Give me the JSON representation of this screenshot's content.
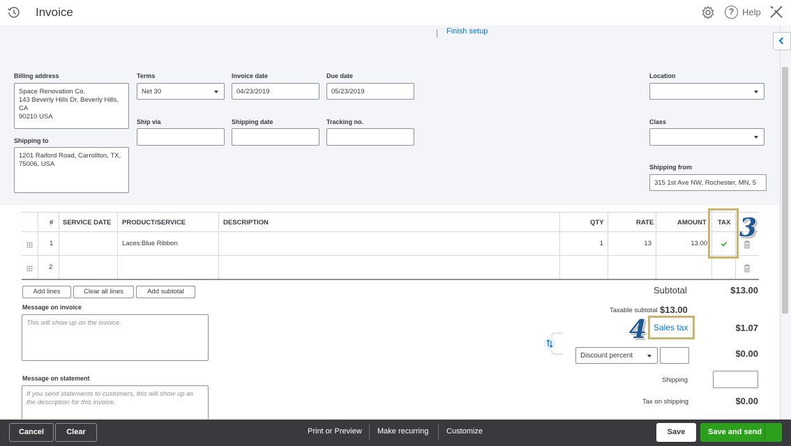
{
  "header": {
    "title": "Invoice",
    "help_label": "Help"
  },
  "setup": {
    "finish_setup": "Finish setup"
  },
  "form": {
    "billing_address_label": "Billing address",
    "billing_address_value": "Space Renovation Co.\n143 Beverly Hills Dr, Beverly Hills, CA\n90210 USA",
    "shipping_to_label": "Shipping to",
    "shipping_to_value": "1201 Raiford Road, Carrollton, TX, 75006, USA",
    "terms_label": "Terms",
    "terms_value": "Net 30",
    "invoice_date_label": "Invoice date",
    "invoice_date_value": "04/23/2019",
    "due_date_label": "Due date",
    "due_date_value": "05/23/2019",
    "ship_via_label": "Ship via",
    "ship_via_value": "",
    "shipping_date_label": "Shipping date",
    "shipping_date_value": "",
    "tracking_no_label": "Tracking no.",
    "tracking_no_value": "",
    "location_label": "Location",
    "location_value": "",
    "class_label": "Class",
    "class_value": "",
    "shipping_from_label": "Shipping from",
    "shipping_from_value": "315 1st Ave NW, Rochester, MN, 5"
  },
  "table": {
    "headers": {
      "num": "#",
      "service_date": "SERVICE DATE",
      "product": "PRODUCT/SERVICE",
      "description": "DESCRIPTION",
      "qty": "QTY",
      "rate": "RATE",
      "amount": "AMOUNT",
      "tax": "TAX"
    },
    "rows": [
      {
        "num": "1",
        "service_date": "",
        "product": "Laces:Blue Ribbon",
        "description": "",
        "qty": "1",
        "rate": "13",
        "amount": "13.00",
        "taxable": true
      },
      {
        "num": "2",
        "service_date": "",
        "product": "",
        "description": "",
        "qty": "",
        "rate": "",
        "amount": "",
        "taxable": false
      }
    ]
  },
  "line_buttons": {
    "add_lines": "Add lines",
    "clear_all_lines": "Clear all lines",
    "add_subtotal": "Add subtotal"
  },
  "messages": {
    "invoice_label": "Message on invoice",
    "invoice_placeholder": "This will show up on the invoice.",
    "statement_label": "Message on statement",
    "statement_placeholder": "If you send statements to customers, this will show up as the description for this invoice."
  },
  "summary": {
    "subtotal_label": "Subtotal",
    "subtotal_value": "$13.00",
    "taxable_subtotal_label": "Taxable subtotal",
    "taxable_subtotal_value": "$13.00",
    "sales_tax_label": "Sales tax",
    "sales_tax_value": "$1.07",
    "discount_select": "Discount percent",
    "discount_value": "$0.00",
    "shipping_label": "Shipping",
    "tax_on_shipping_label": "Tax on shipping",
    "tax_on_shipping_value": "$0.00"
  },
  "callouts": {
    "step3": "3",
    "step4": "4"
  },
  "footer": {
    "cancel": "Cancel",
    "clear": "Clear",
    "print_preview": "Print or Preview",
    "make_recurring": "Make recurring",
    "customize": "Customize",
    "save": "Save",
    "save_and_send": "Save and send"
  },
  "colors": {
    "link_blue": "#0077c5",
    "brand_green": "#2ca01c",
    "footer_dark": "#393a3d",
    "highlight_gold": "#c9b46e",
    "callout_blue": "#1f5694"
  }
}
